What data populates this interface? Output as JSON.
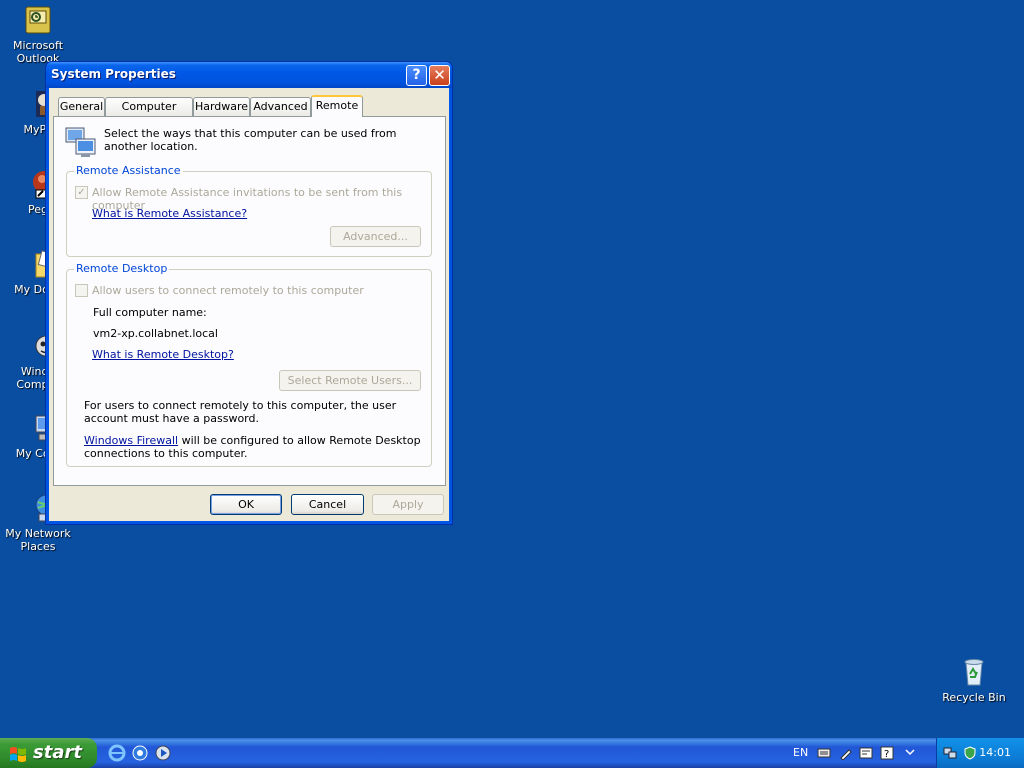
{
  "desktop": {
    "icons": [
      {
        "label": "Microsoft\nOutlook"
      },
      {
        "label": "MyPa"
      },
      {
        "label": "Peg"
      },
      {
        "label": "My Docu"
      },
      {
        "label": "Windo\nCompat"
      },
      {
        "label": "My Com"
      },
      {
        "label": "My Network\nPlaces"
      },
      {
        "label": "Recycle Bin"
      }
    ]
  },
  "window": {
    "title": "System Properties",
    "help_glyph": "?",
    "close_glyph": "✕",
    "tabs": [
      {
        "label": "General"
      },
      {
        "label": "Computer Name"
      },
      {
        "label": "Hardware"
      },
      {
        "label": "Advanced"
      },
      {
        "label": "Remote"
      }
    ],
    "intro": "Select the ways that this computer can be used from another location.",
    "remote_assistance": {
      "title": "Remote Assistance",
      "checkbox_label": "Allow Remote Assistance invitations to be sent from this computer",
      "checkbox_checked": true,
      "link": "What is Remote Assistance?",
      "advanced_button": "Advanced..."
    },
    "remote_desktop": {
      "title": "Remote Desktop",
      "checkbox_label": "Allow users to connect remotely to this computer",
      "full_name_label": "Full computer name:",
      "full_name_value": "vm2-xp.collabnet.local",
      "link": "What is Remote Desktop?",
      "select_users_button": "Select Remote Users...",
      "note": "For users to connect remotely to this computer, the user account must have a password.",
      "firewall_link": "Windows Firewall",
      "firewall_text": " will be configured to allow Remote Desktop connections to this computer."
    },
    "buttons": {
      "ok": "OK",
      "cancel": "Cancel",
      "apply": "Apply"
    }
  },
  "taskbar": {
    "start_label": "start",
    "language": "EN",
    "clock": "14:01"
  },
  "colors": {
    "desktop": "#0a4ea2",
    "group_title": "#0046d5",
    "link": "#00139f"
  }
}
